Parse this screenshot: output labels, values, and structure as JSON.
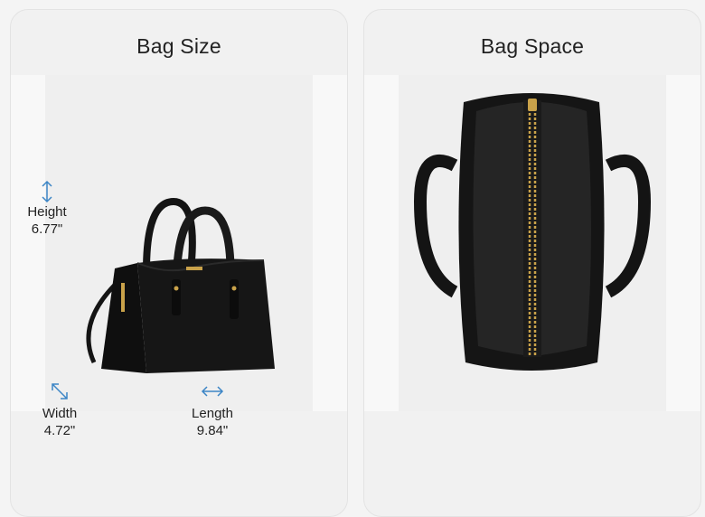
{
  "size_card": {
    "title": "Bag Size",
    "measurements": {
      "height": {
        "label": "Height",
        "value": "6.77\""
      },
      "width": {
        "label": "Width",
        "value": "4.72\""
      },
      "length": {
        "label": "Length",
        "value": "9.84\""
      }
    }
  },
  "space_card": {
    "title": "Bag Space"
  },
  "colors": {
    "arrow": "#3d86c6",
    "bag": "#141414",
    "hardware": "#c9a24a"
  }
}
